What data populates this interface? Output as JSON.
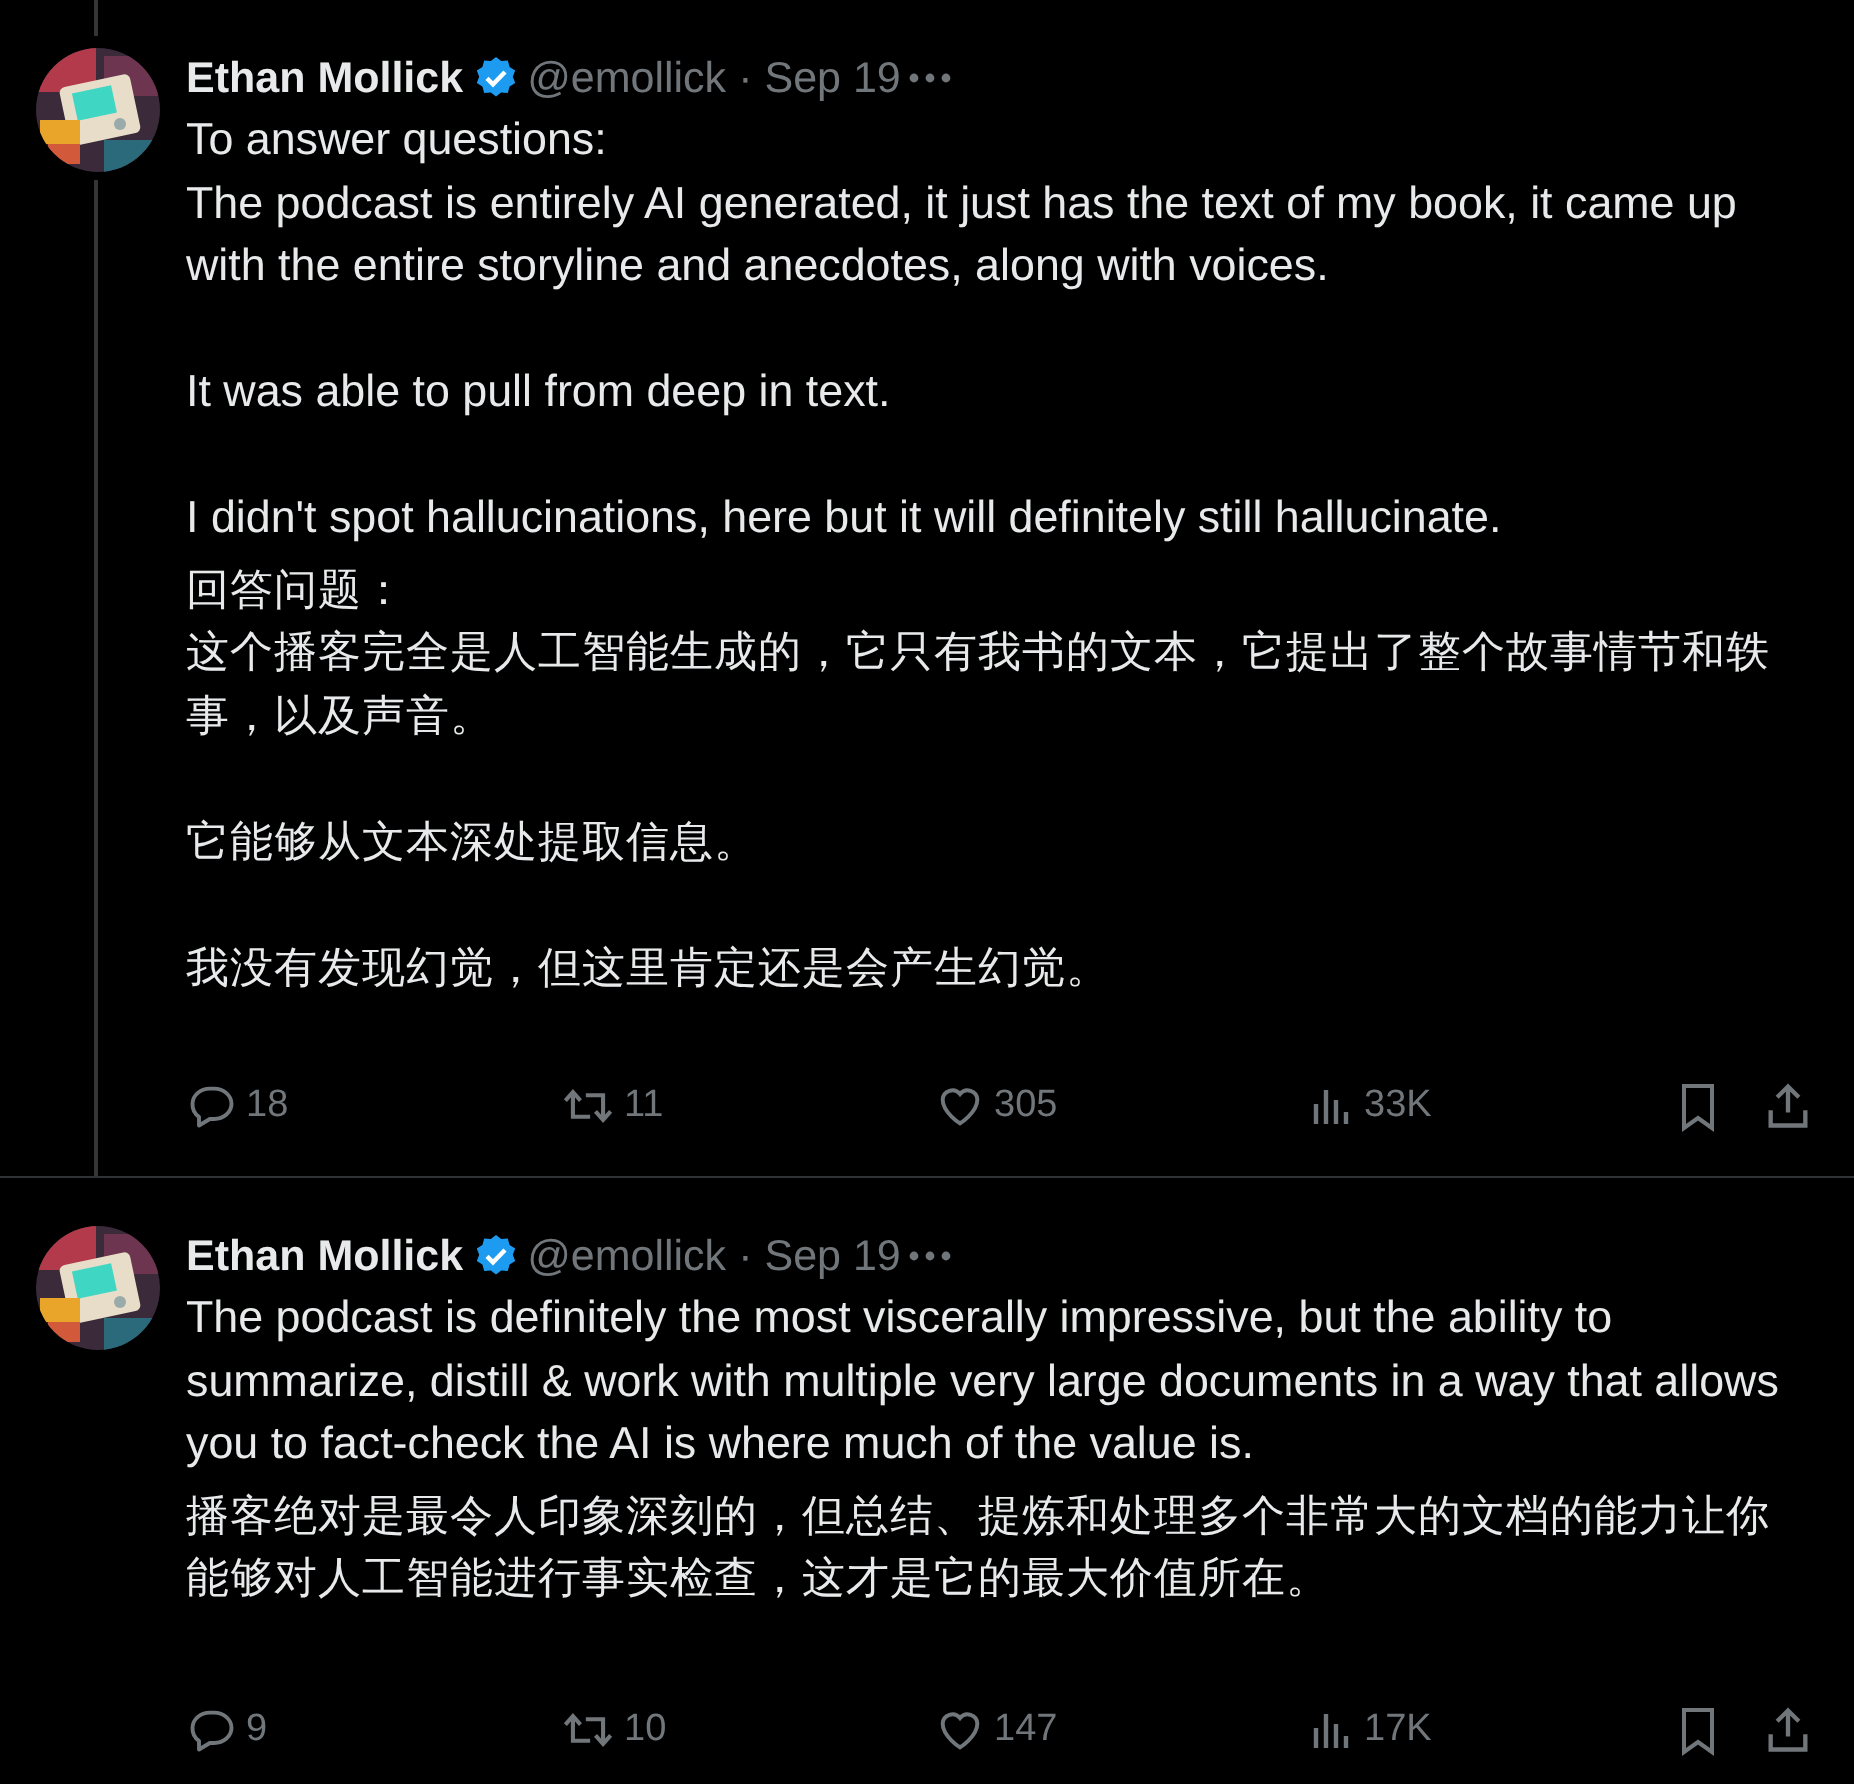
{
  "tweets": [
    {
      "author": {
        "name": "Ethan Mollick",
        "verified": true,
        "handle": "@emollick",
        "separator": "·",
        "date": "Sep 19"
      },
      "thread_line": true,
      "text": [
        [
          "To answer questions:",
          "The podcast is entirely AI generated, it just has the text of my book, it came up with the entire storyline and anecdotes, along with voices."
        ],
        [
          "It was able to pull from deep in text."
        ],
        [
          "I didn't spot hallucinations, here but it will definitely still hallucinate."
        ]
      ],
      "translation": [
        [
          "回答问题：",
          "这个播客完全是人工智能生成的，它只有我书的文本，它提出了整个故事情节和轶事，以及声音。"
        ],
        [
          "它能够从文本深处提取信息。"
        ],
        [
          "我没有发现幻觉，但这里肯定还是会产生幻觉。"
        ]
      ],
      "replies": "18",
      "reposts": "11",
      "likes": "305",
      "views": "33K"
    },
    {
      "author": {
        "name": "Ethan Mollick",
        "verified": true,
        "handle": "@emollick",
        "separator": "·",
        "date": "Sep 19"
      },
      "thread_line": false,
      "text": [
        [
          "The podcast is definitely the most viscerally impressive, but the ability to summarize, distill & work with multiple very large documents in a way that allows you to fact-check the AI is where much of the value is."
        ]
      ],
      "translation": [
        [
          "播客绝对是最令人印象深刻的，但总结、提炼和处理多个非常大的文档的能力让你能够对人工智能进行事实检查，这才是它的最大价值所在。"
        ]
      ],
      "replies": "9",
      "reposts": "10",
      "likes": "147",
      "views": "17K"
    }
  ]
}
